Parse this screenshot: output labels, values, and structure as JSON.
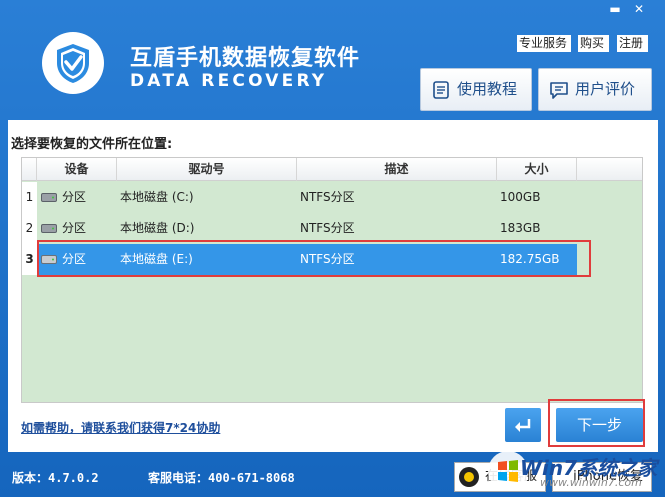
{
  "window": {
    "minimize": "▬",
    "close": "✕"
  },
  "header": {
    "title_cn": "互盾手机数据恢复软件",
    "title_en": "DATA RECOVERY",
    "links": {
      "pro_service": "专业服务",
      "buy": "购买",
      "register": "注册"
    },
    "buttons": {
      "tutorial": "使用教程",
      "review": "用户评价"
    }
  },
  "main": {
    "prompt": "选择要恢复的文件所在位置:",
    "table": {
      "columns": [
        "设备",
        "驱动号",
        "描述",
        "大小"
      ],
      "rows": [
        {
          "num": "1",
          "device": "分区",
          "drive": "本地磁盘 (C:)",
          "desc": "NTFS分区",
          "size": "100GB",
          "selected": false
        },
        {
          "num": "2",
          "device": "分区",
          "drive": "本地磁盘 (D:)",
          "desc": "NTFS分区",
          "size": "183GB",
          "selected": false
        },
        {
          "num": "3",
          "device": "分区",
          "drive": "本地磁盘 (E:)",
          "desc": "NTFS分区",
          "size": "182.75GB",
          "selected": true
        }
      ]
    },
    "help_link": "如需帮助，请联系我们获得7*24协助",
    "next_button": "下一步"
  },
  "footer": {
    "version": "版本：4.7.0.2",
    "phone": "客服电话：400-671-8068",
    "support": "在线客服",
    "iphone": "iPhone恢复"
  },
  "watermark": {
    "text": "Win7系统之家",
    "url": "www.winwin7.com"
  },
  "colors": {
    "background": "#1e6fc6",
    "table_bg": "#d2e8d1",
    "selected_row": "#3496e8",
    "highlight_outline": "#e03c3c",
    "button_blue": "#2a82d4"
  }
}
